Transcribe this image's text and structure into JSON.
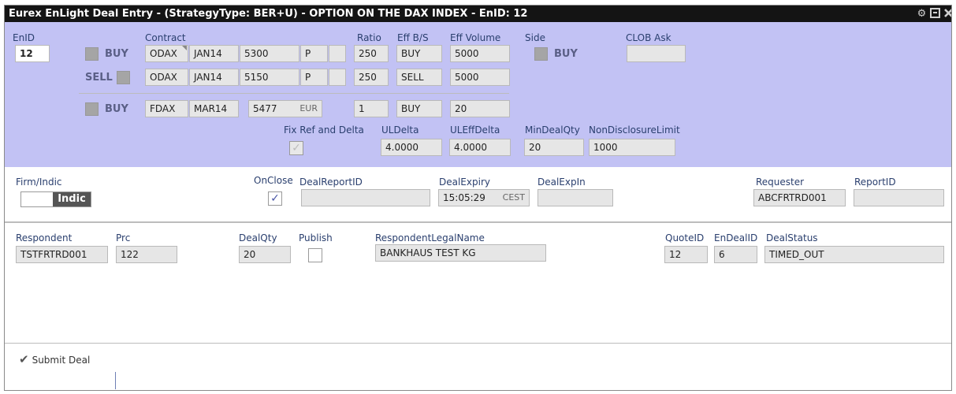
{
  "window": {
    "title": "Eurex EnLight Deal Entry - (StrategyType: BER+U) - OPTION ON THE DAX INDEX - EnID: 12",
    "icons": [
      "gear-icon",
      "maximize-icon",
      "close-icon"
    ]
  },
  "header": {
    "labels": {
      "enid": "EnID",
      "contract": "Contract",
      "ratio": "Ratio",
      "eff_bs": "Eff B/S",
      "eff_volume": "Eff Volume",
      "side": "Side",
      "clob_ask": "CLOB Ask"
    },
    "enid": "12",
    "side_value": "BUY",
    "clob_ask": ""
  },
  "legs": [
    {
      "side": "BUY",
      "product": "ODAX",
      "expiry": "JAN14",
      "strike": "5300",
      "type": "P",
      "extra": "",
      "ratio": "250",
      "eff_bs": "BUY",
      "eff_volume": "5000"
    },
    {
      "side": "SELL",
      "product": "ODAX",
      "expiry": "JAN14",
      "strike": "5150",
      "type": "P",
      "extra": "",
      "ratio": "250",
      "eff_bs": "SELL",
      "eff_volume": "5000"
    },
    {
      "side": "BUY",
      "product": "FDAX",
      "expiry": "MAR14",
      "strike": "5477",
      "unit": "EUR",
      "ratio": "1",
      "eff_bs": "BUY",
      "eff_volume": "20"
    }
  ],
  "delta": {
    "fix_label": "Fix Ref and Delta",
    "fix_checked": true,
    "uldelta_label": "ULDelta",
    "uldelta": "4.0000",
    "uleffdelta_label": "ULEffDelta",
    "uleffdelta": "4.0000",
    "mindealqty_label": "MinDealQty",
    "mindealqty": "20",
    "nondisclosure_label": "NonDisclosureLimit",
    "nondisclosure": "1000"
  },
  "deal": {
    "firm_indic_label": "Firm/Indic",
    "firm_indic_value": "Indic",
    "onclose_label": "OnClose",
    "onclose_checked": true,
    "dealreportid_label": "DealReportID",
    "dealreportid": "",
    "dealexpiry_label": "DealExpiry",
    "dealexpiry": "15:05:29",
    "dealexpiry_tz": "CEST",
    "dealexpin_label": "DealExpIn",
    "dealexpin": "",
    "requester_label": "Requester",
    "requester": "ABCFRTRD001",
    "reportid_label": "ReportID",
    "reportid": ""
  },
  "respondent": {
    "respondent_label": "Respondent",
    "respondent": "TSTFRTRD001",
    "prc_label": "Prc",
    "prc": "122",
    "dealqty_label": "DealQty",
    "dealqty": "20",
    "publish_label": "Publish",
    "publish_checked": false,
    "legalname_label": "RespondentLegalName",
    "legalname": "BANKHAUS TEST KG",
    "quoteid_label": "QuoteID",
    "quoteid": "12",
    "endealid_label": "EnDealID",
    "endealid": "6",
    "dealstatus_label": "DealStatus",
    "dealstatus": "TIMED_OUT"
  },
  "footer": {
    "submit_label": "Submit Deal"
  },
  "colors": {
    "upper_bg": "#c2c2f4",
    "title_bg": "#141414",
    "label": "#2a3f6e"
  }
}
